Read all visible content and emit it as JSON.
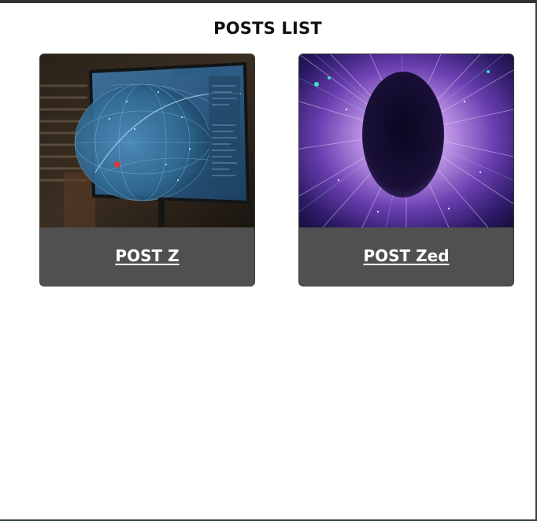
{
  "page": {
    "title": "POSTS LIST"
  },
  "posts": [
    {
      "title": "POST Z",
      "image_subject": "holographic globe display screen"
    },
    {
      "title": "POST Zed",
      "image_subject": "dark oval portal with light streaks"
    }
  ]
}
